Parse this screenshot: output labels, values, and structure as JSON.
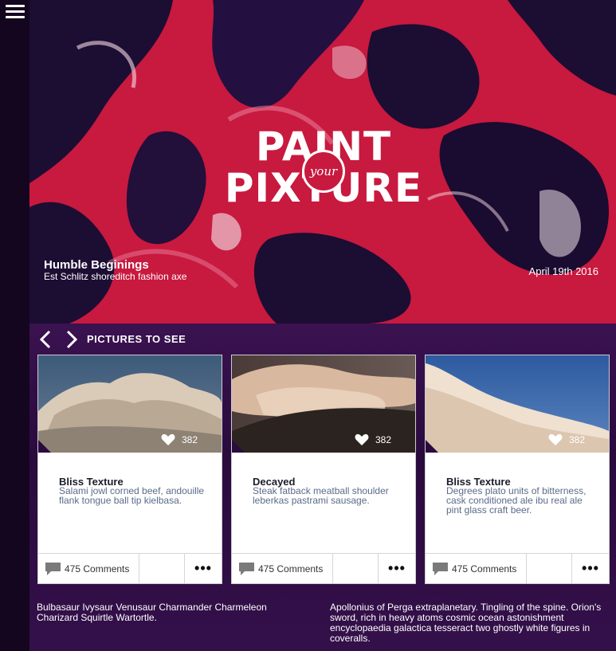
{
  "hero": {
    "logo_line1": "PAINT",
    "logo_line2": "PIXTURE",
    "logo_badge": "your",
    "title": "Humble Beginings",
    "subtitle": "Est Schlitz shoreditch fashion axe",
    "date": "April 19th 2016"
  },
  "section": {
    "title": "PICTURES TO SEE"
  },
  "cards": [
    {
      "title": "Bliss Texture",
      "description": "Salami jowl corned beef, andouille flank tongue ball tip kielbasa.",
      "likes": "382",
      "comments": "475 Comments",
      "more": "•••"
    },
    {
      "title": "Decayed",
      "description": "Steak fatback meatball shoulder leberkas pastrami sausage.",
      "likes": "382",
      "comments": "475 Comments",
      "more": "•••"
    },
    {
      "title": "Bliss Texture",
      "description": "Degrees plato units of bitterness, cask conditioned ale ibu real ale pint glass craft beer.",
      "likes": "382",
      "comments": "475 Comments",
      "more": "•••"
    }
  ],
  "footer": {
    "left": "Bulbasaur Ivysaur Venusaur Charmander Charmeleon Charizard Squirtle Wartortle.",
    "right": "Apollonius of Perga extraplanetary. Tingling of the spine. Orion's sword, rich in heavy atoms cosmic ocean astonishment encyclopaedia galactica tesseract two ghostly white figures in coveralls."
  },
  "icons": {
    "menu": "hamburger-menu-icon",
    "prev": "chevron-left-icon",
    "next": "chevron-right-icon",
    "heart": "heart-icon",
    "comment": "comment-bubble-icon"
  },
  "colors": {
    "hero_red": "#c8193f",
    "hero_dark": "#1c0d33",
    "section_bg": "#2a0b3e",
    "desc_text": "#5a6b8a"
  }
}
